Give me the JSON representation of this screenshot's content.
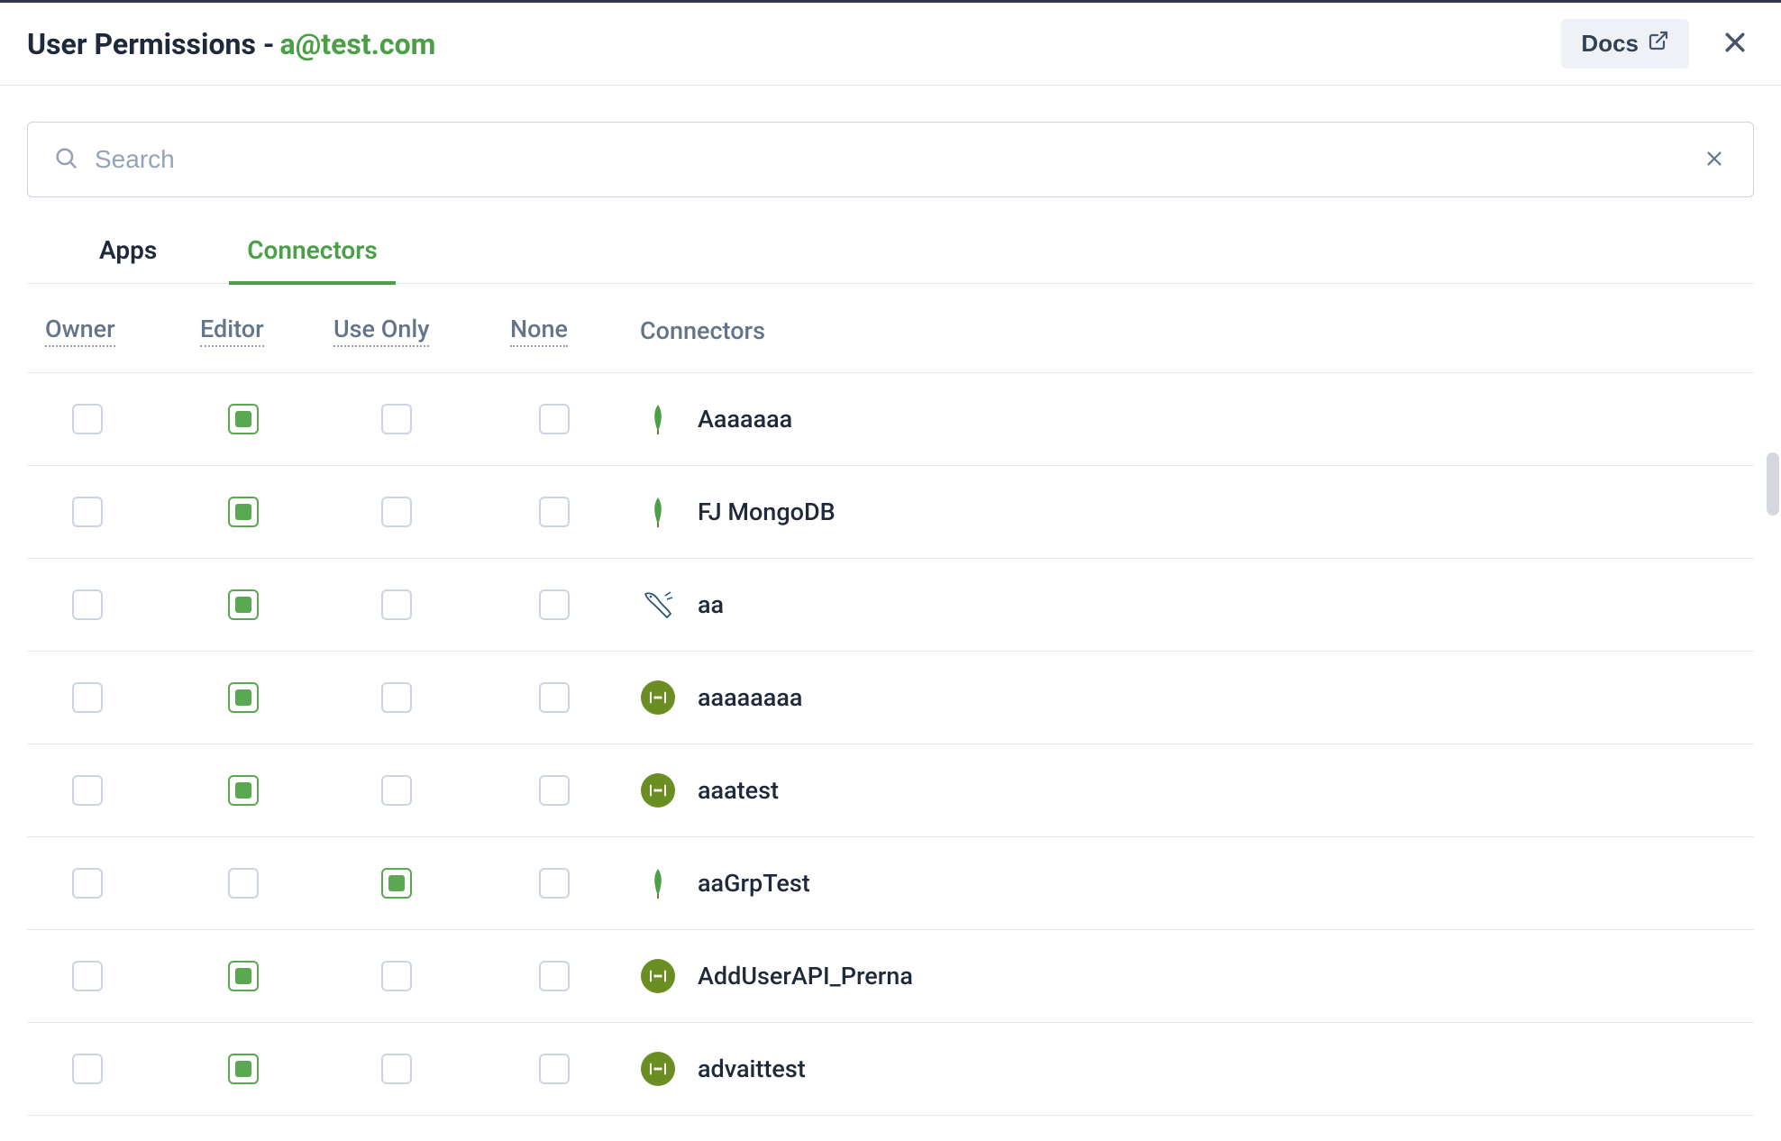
{
  "header": {
    "title_prefix": "User Permissions - ",
    "email": "a@test.com",
    "docs_label": "Docs"
  },
  "search": {
    "placeholder": "Search",
    "value": ""
  },
  "tabs": [
    {
      "label": "Apps",
      "active": false
    },
    {
      "label": "Connectors",
      "active": true
    }
  ],
  "columns": {
    "owner": "Owner",
    "editor": "Editor",
    "useonly": "Use Only",
    "none": "None",
    "connectors": "Connectors"
  },
  "rows": [
    {
      "name": "Aaaaaaa",
      "icon": "mongo",
      "owner": false,
      "editor": true,
      "useonly": false,
      "none": false
    },
    {
      "name": "FJ MongoDB",
      "icon": "mongo",
      "owner": false,
      "editor": true,
      "useonly": false,
      "none": false
    },
    {
      "name": "aa",
      "icon": "mysql",
      "owner": false,
      "editor": true,
      "useonly": false,
      "none": false
    },
    {
      "name": "aaaaaaaa",
      "icon": "rest",
      "owner": false,
      "editor": true,
      "useonly": false,
      "none": false
    },
    {
      "name": "aaatest",
      "icon": "rest",
      "owner": false,
      "editor": true,
      "useonly": false,
      "none": false
    },
    {
      "name": "aaGrpTest",
      "icon": "mongo",
      "owner": false,
      "editor": false,
      "useonly": true,
      "none": false
    },
    {
      "name": "AddUserAPI_Prerna",
      "icon": "rest",
      "owner": false,
      "editor": true,
      "useonly": false,
      "none": false
    },
    {
      "name": "advaittest",
      "icon": "rest",
      "owner": false,
      "editor": true,
      "useonly": false,
      "none": false
    }
  ]
}
